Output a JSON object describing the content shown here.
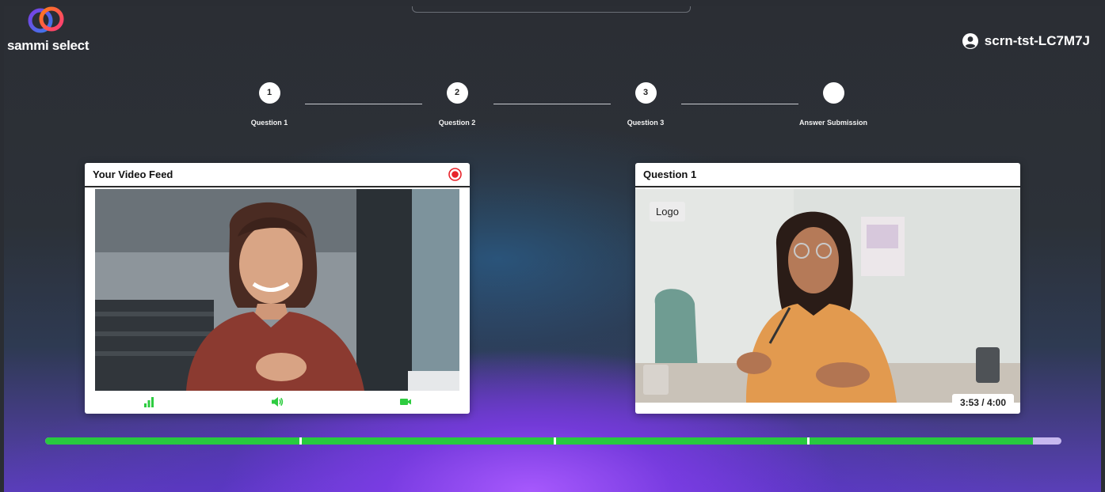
{
  "brand": {
    "name": "sammi select"
  },
  "user": {
    "id": "scrn-tst-LC7M7J"
  },
  "steps": [
    {
      "number": "1",
      "label": "Question 1"
    },
    {
      "number": "2",
      "label": "Question 2"
    },
    {
      "number": "3",
      "label": "Question 3"
    },
    {
      "number": "",
      "label": "Answer Submission"
    }
  ],
  "video_feed": {
    "title": "Your Video Feed",
    "icons": [
      "signal-icon",
      "speaker-icon",
      "camera-icon"
    ],
    "status_color": "#2ecc40",
    "record_color": "#e8242b"
  },
  "question": {
    "title": "Question 1",
    "logo_label": "Logo",
    "timer": "3:53 / 4:00"
  },
  "progress": {
    "fraction": 0.972,
    "segments": 4,
    "fill_color": "#28c93f",
    "track_color": "#c7b8ef"
  }
}
